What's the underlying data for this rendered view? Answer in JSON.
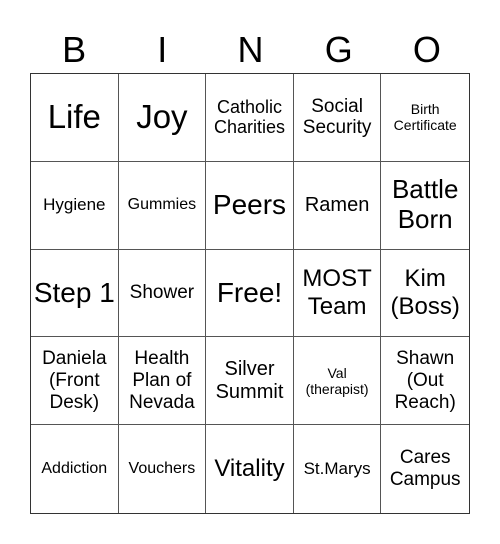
{
  "header": [
    "B",
    "I",
    "N",
    "G",
    "O"
  ],
  "cells": [
    [
      "Life",
      "Joy",
      "Catholic Charities",
      "Social Security",
      "Birth Certificate"
    ],
    [
      "Hygiene",
      "Gummies",
      "Peers",
      "Ramen",
      "Battle Born"
    ],
    [
      "Step 1",
      "Shower",
      "Free!",
      "MOST Team",
      "Kim (Boss)"
    ],
    [
      "Daniela (Front Desk)",
      "Health Plan of Nevada",
      "Silver Summit",
      "Val (therapist)",
      "Shawn (Out Reach)"
    ],
    [
      "Addiction",
      "Vouchers",
      "Vitality",
      "St.Marys",
      "Cares Campus"
    ]
  ]
}
